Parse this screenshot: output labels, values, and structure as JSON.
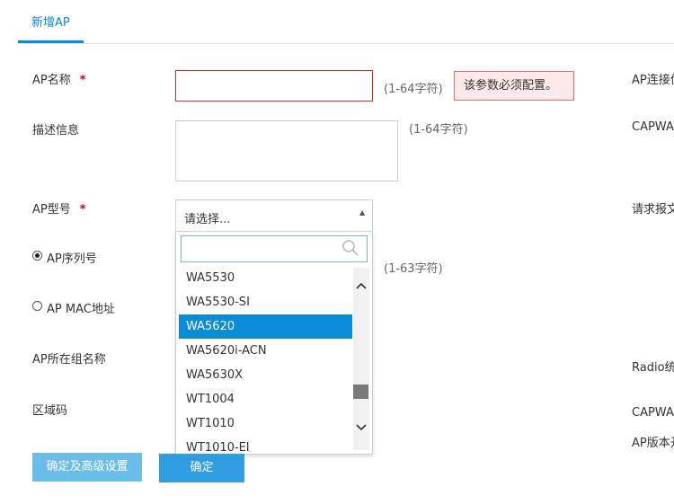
{
  "tab": {
    "label": "新增AP"
  },
  "form": {
    "ap_name": {
      "label": "AP名称",
      "required_mark": "*",
      "value": "",
      "hint": "(1-64字符)",
      "error": "该参数必须配置。"
    },
    "description": {
      "label": "描述信息",
      "value": "",
      "hint": "(1-64字符)"
    },
    "ap_model": {
      "label": "AP型号",
      "required_mark": "*",
      "selected_display": "请选择...",
      "search_value": "",
      "options": [
        "WA5530",
        "WA5530-SI",
        "WA5620",
        "WA5620i-ACN",
        "WA5630X",
        "WT1004",
        "WT1010",
        "WT1010-EI"
      ],
      "highlighted": "WA5620"
    },
    "ap_serial": {
      "label": "AP序列号",
      "hint": "(1-63字符)",
      "checked": true
    },
    "ap_mac": {
      "label": "AP MAC地址",
      "checked": false
    },
    "ap_group": {
      "label": "AP所在组名称"
    },
    "region_code": {
      "label": "区域码"
    }
  },
  "right_labels": [
    "AP连接优",
    "CAPWAP",
    "请求报文",
    "Radio统",
    "CAPWAP",
    "AP版本开"
  ],
  "buttons": {
    "advanced": "确定及高级设置",
    "ok": "确定"
  },
  "colors": {
    "accent": "#0a8cd6",
    "error_border": "#c9302c",
    "error_bg": "#fde9e9"
  }
}
